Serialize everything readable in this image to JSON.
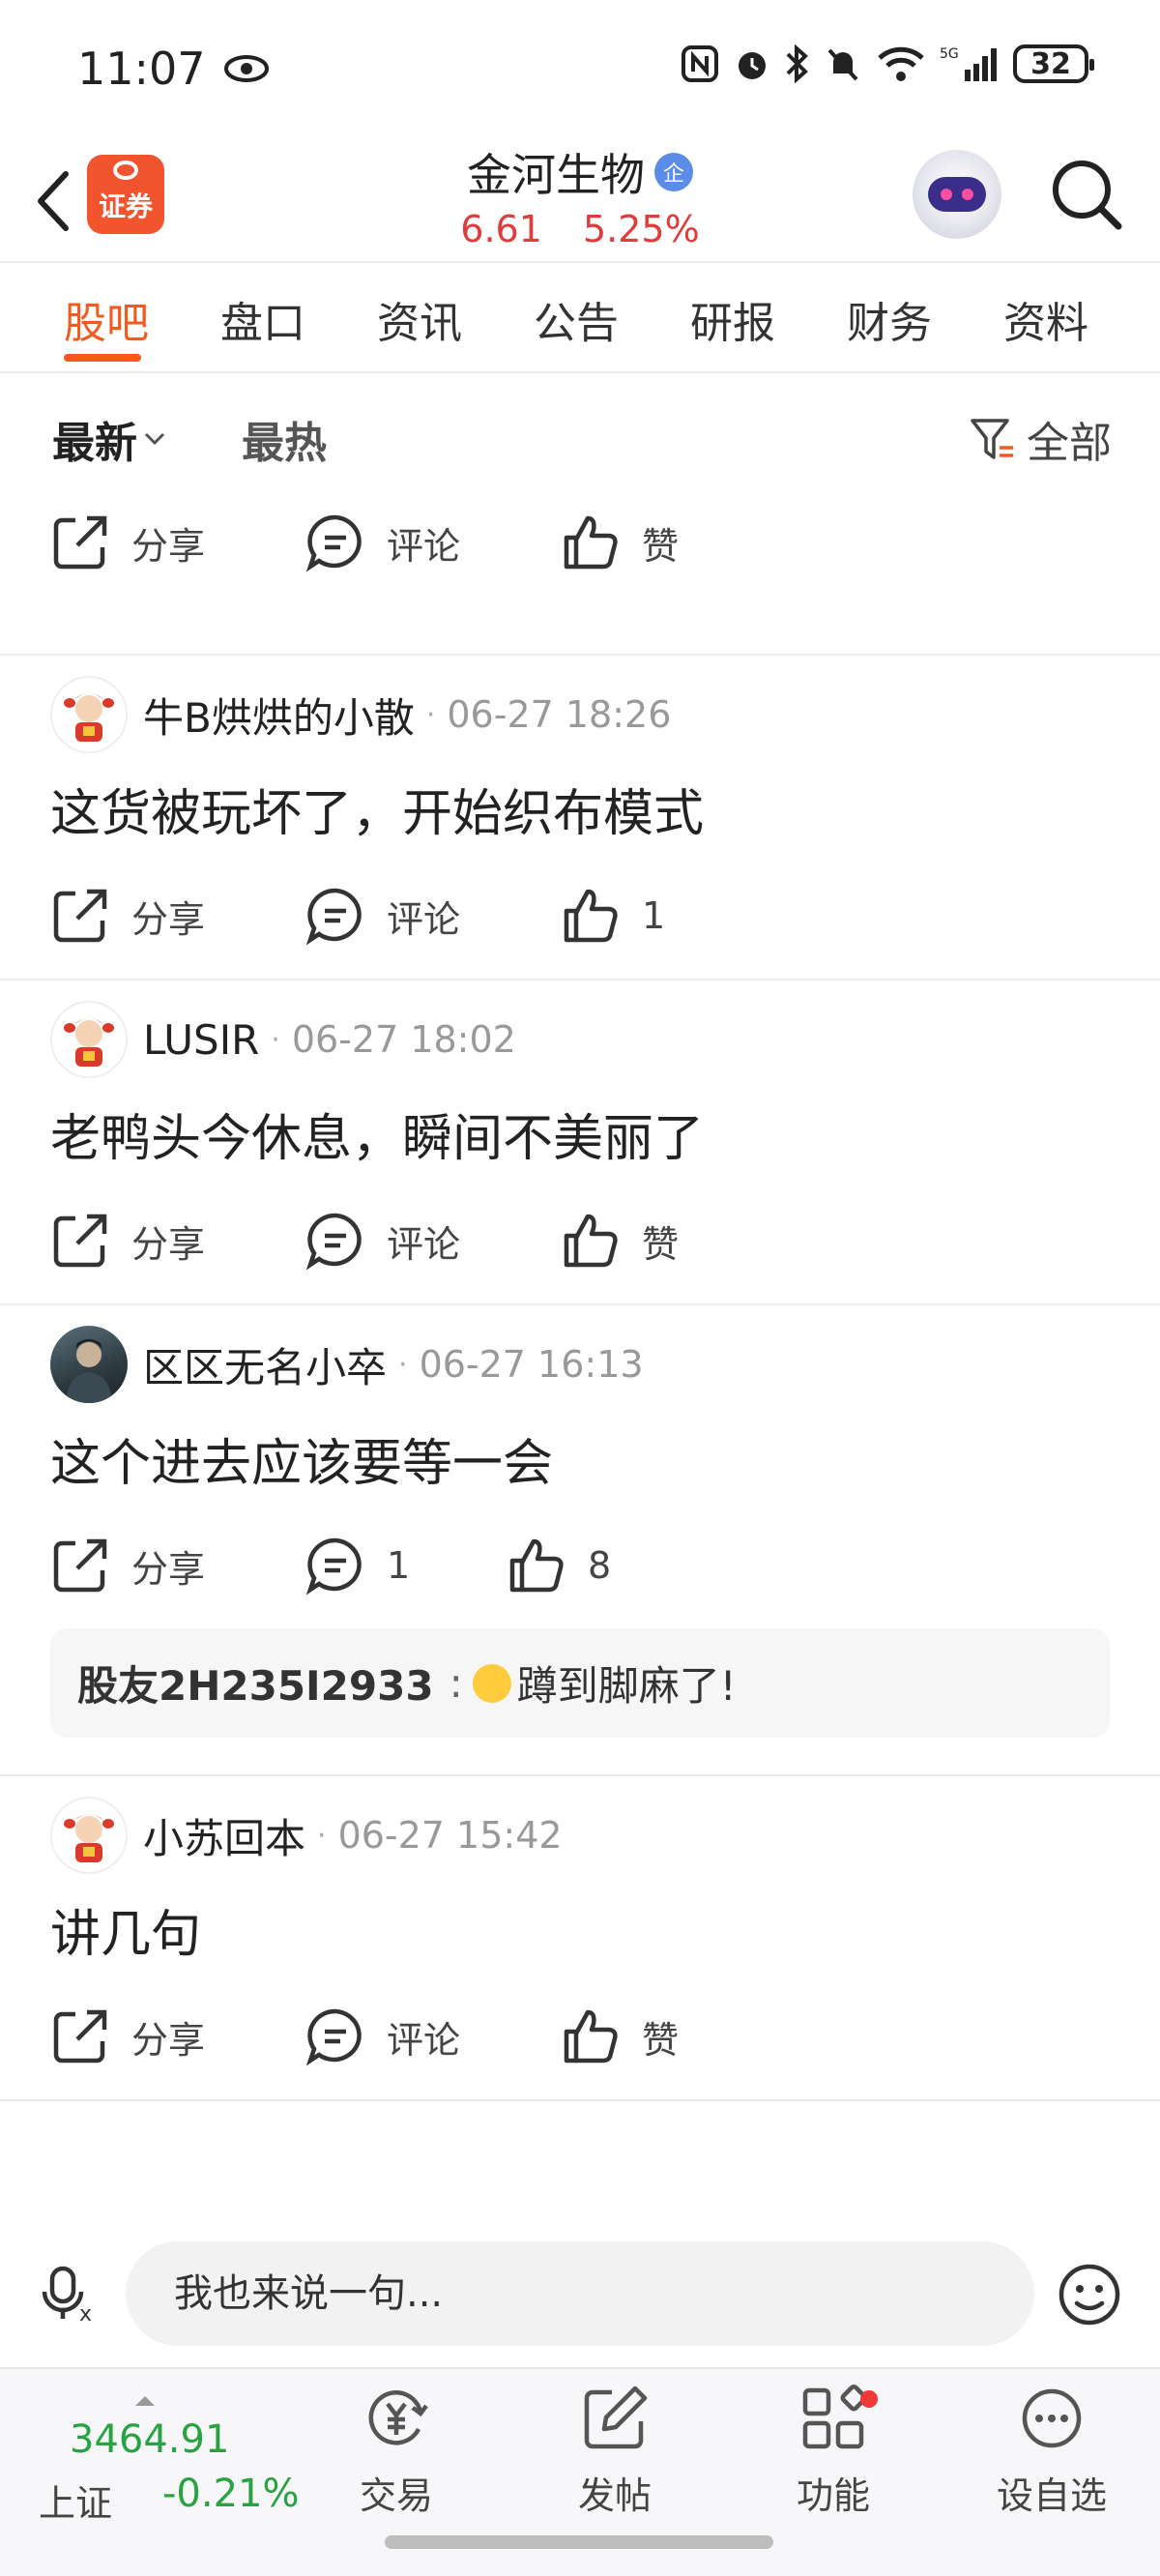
{
  "status_bar": {
    "time": "11:07",
    "battery": "32"
  },
  "header": {
    "brand_logo_text": "证券",
    "stock_name": "金河生物",
    "verify_badge": "企",
    "price": "6.61",
    "change_pct": "5.25%"
  },
  "tabs": [
    "股吧",
    "盘口",
    "资讯",
    "公告",
    "研报",
    "财务",
    "资料"
  ],
  "filter": {
    "latest": "最新",
    "hot": "最热",
    "all": "全部"
  },
  "actions": {
    "share": "分享",
    "comment": "评论",
    "like": "赞"
  },
  "posts": [
    {
      "username": "牛B烘烘的小散",
      "time": "06-27 18:26",
      "content": "这货被玩坏了，开始织布模式",
      "comment_label": "评论",
      "like_label": "1"
    },
    {
      "username": "LUSIR",
      "time": "06-27 18:02",
      "content": "老鸭头今休息，瞬间不美丽了",
      "comment_label": "评论",
      "like_label": "赞"
    },
    {
      "username": "区区无名小卒",
      "time": "06-27 16:13",
      "content": "这个进去应该要等一会",
      "comment_label": "1",
      "like_label": "8",
      "reply": {
        "user": "股友2H235I2933",
        "text": "蹲到脚麻了!"
      }
    },
    {
      "username": "小苏回本",
      "time": "06-27 15:42",
      "content": "讲几句",
      "comment_label": "评论",
      "like_label": "赞"
    }
  ],
  "input_bar": {
    "placeholder": "我也来说一句..."
  },
  "bottom_nav": {
    "index_value": "3464.91",
    "index_name": "上证",
    "index_change": "-0.21%",
    "items": [
      "交易",
      "发帖",
      "功能",
      "设自选"
    ]
  },
  "colors": {
    "accent": "#f25b1d",
    "up": "#e03c3c",
    "down": "#27a342"
  }
}
